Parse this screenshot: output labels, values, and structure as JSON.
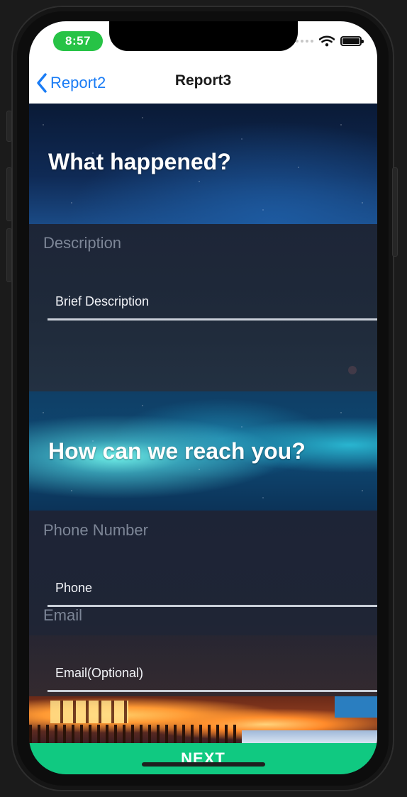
{
  "status_bar": {
    "time": "8:57",
    "icons": [
      "cellular-signal-icon",
      "wifi-icon",
      "battery-icon"
    ]
  },
  "nav": {
    "back_label": "Report2",
    "title": "Report3"
  },
  "sections": {
    "what_happened": {
      "title": "What happened?",
      "description_label": "Description",
      "description_placeholder": "Brief Description",
      "description_value": ""
    },
    "contact": {
      "title": "How can we reach you?",
      "phone_label": "Phone Number",
      "phone_placeholder": "Phone",
      "phone_value": "",
      "email_label": "Email",
      "email_placeholder": "Email(Optional)",
      "email_value": ""
    }
  },
  "footer": {
    "next_label": "NEXT"
  },
  "colors": {
    "accent_blue": "#1a7cf5",
    "next_green": "#10c981",
    "time_pill_green": "#27c346"
  }
}
